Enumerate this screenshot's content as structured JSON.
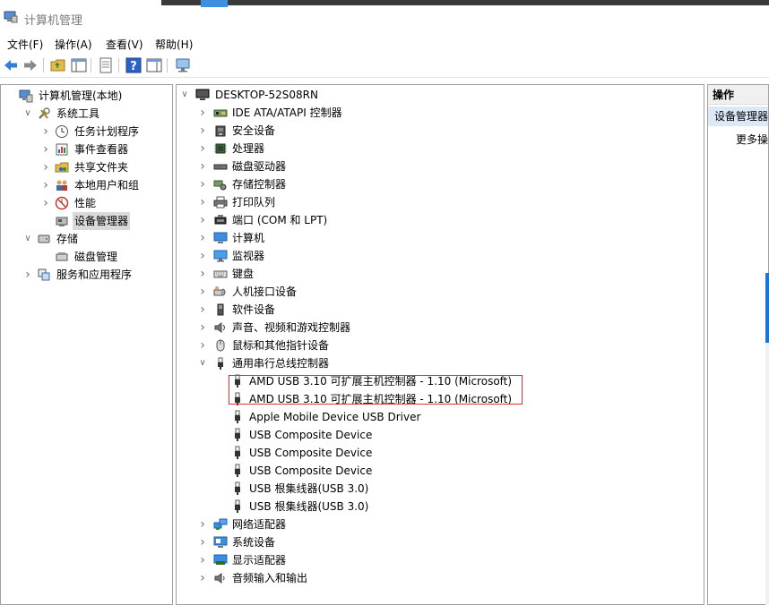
{
  "window": {
    "title": "计算机管理"
  },
  "menu": [
    "文件(F)",
    "操作(A)",
    "查看(V)",
    "帮助(H)"
  ],
  "left_tree": [
    {
      "label": "计算机管理(本地)",
      "level": 0,
      "expanded": "none",
      "icon": "computer-mgmt-icon"
    },
    {
      "label": "系统工具",
      "level": 1,
      "expanded": "open",
      "icon": "tools-icon"
    },
    {
      "label": "任务计划程序",
      "level": 2,
      "expanded": "closed",
      "icon": "clock-icon"
    },
    {
      "label": "事件查看器",
      "level": 2,
      "expanded": "closed",
      "icon": "event-viewer-icon"
    },
    {
      "label": "共享文件夹",
      "level": 2,
      "expanded": "closed",
      "icon": "shared-folder-icon"
    },
    {
      "label": "本地用户和组",
      "level": 2,
      "expanded": "closed",
      "icon": "users-icon"
    },
    {
      "label": "性能",
      "level": 2,
      "expanded": "closed",
      "icon": "performance-icon"
    },
    {
      "label": "设备管理器",
      "level": 2,
      "expanded": "none",
      "icon": "device-manager-icon",
      "selected": true
    },
    {
      "label": "存储",
      "level": 1,
      "expanded": "open",
      "icon": "storage-icon"
    },
    {
      "label": "磁盘管理",
      "level": 2,
      "expanded": "none",
      "icon": "disk-mgmt-icon"
    },
    {
      "label": "服务和应用程序",
      "level": 1,
      "expanded": "closed",
      "icon": "services-icon"
    }
  ],
  "device_tree": {
    "root": "DESKTOP-52S08RN",
    "categories": [
      {
        "label": "IDE ATA/ATAPI 控制器",
        "icon": "ide-controller-icon",
        "expanded": false
      },
      {
        "label": "安全设备",
        "icon": "security-device-icon",
        "expanded": false
      },
      {
        "label": "处理器",
        "icon": "processor-icon",
        "expanded": false
      },
      {
        "label": "磁盘驱动器",
        "icon": "disk-drive-icon",
        "expanded": false
      },
      {
        "label": "存储控制器",
        "icon": "storage-controller-icon",
        "expanded": false
      },
      {
        "label": "打印队列",
        "icon": "printer-icon",
        "expanded": false
      },
      {
        "label": "端口 (COM 和 LPT)",
        "icon": "port-icon",
        "expanded": false
      },
      {
        "label": "计算机",
        "icon": "computer-icon",
        "expanded": false
      },
      {
        "label": "监视器",
        "icon": "monitor-icon",
        "expanded": false
      },
      {
        "label": "键盘",
        "icon": "keyboard-icon",
        "expanded": false
      },
      {
        "label": "人机接口设备",
        "icon": "hid-icon",
        "expanded": false
      },
      {
        "label": "软件设备",
        "icon": "software-device-icon",
        "expanded": false
      },
      {
        "label": "声音、视频和游戏控制器",
        "icon": "sound-icon",
        "expanded": false
      },
      {
        "label": "鼠标和其他指针设备",
        "icon": "mouse-icon",
        "expanded": false
      },
      {
        "label": "通用串行总线控制器",
        "icon": "usb-icon",
        "expanded": true,
        "children": [
          "AMD USB 3.10 可扩展主机控制器 - 1.10 (Microsoft)",
          "AMD USB 3.10 可扩展主机控制器 - 1.10 (Microsoft)",
          "Apple Mobile Device USB Driver",
          "USB Composite Device",
          "USB Composite Device",
          "USB Composite Device",
          "USB 根集线器(USB 3.0)",
          "USB 根集线器(USB 3.0)"
        ]
      },
      {
        "label": "网络适配器",
        "icon": "network-adapter-icon",
        "expanded": false
      },
      {
        "label": "系统设备",
        "icon": "system-device-icon",
        "expanded": false
      },
      {
        "label": "显示适配器",
        "icon": "display-adapter-icon",
        "expanded": false
      },
      {
        "label": "音频输入和输出",
        "icon": "audio-io-icon",
        "expanded": false
      }
    ]
  },
  "actions_pane": {
    "header": "操作",
    "selected_item": "设备管理器",
    "more": "更多操"
  },
  "colors": {
    "highlight_box": "#e03030",
    "selection": "#d9d9d9",
    "action_selected": "#dbe8f7"
  }
}
